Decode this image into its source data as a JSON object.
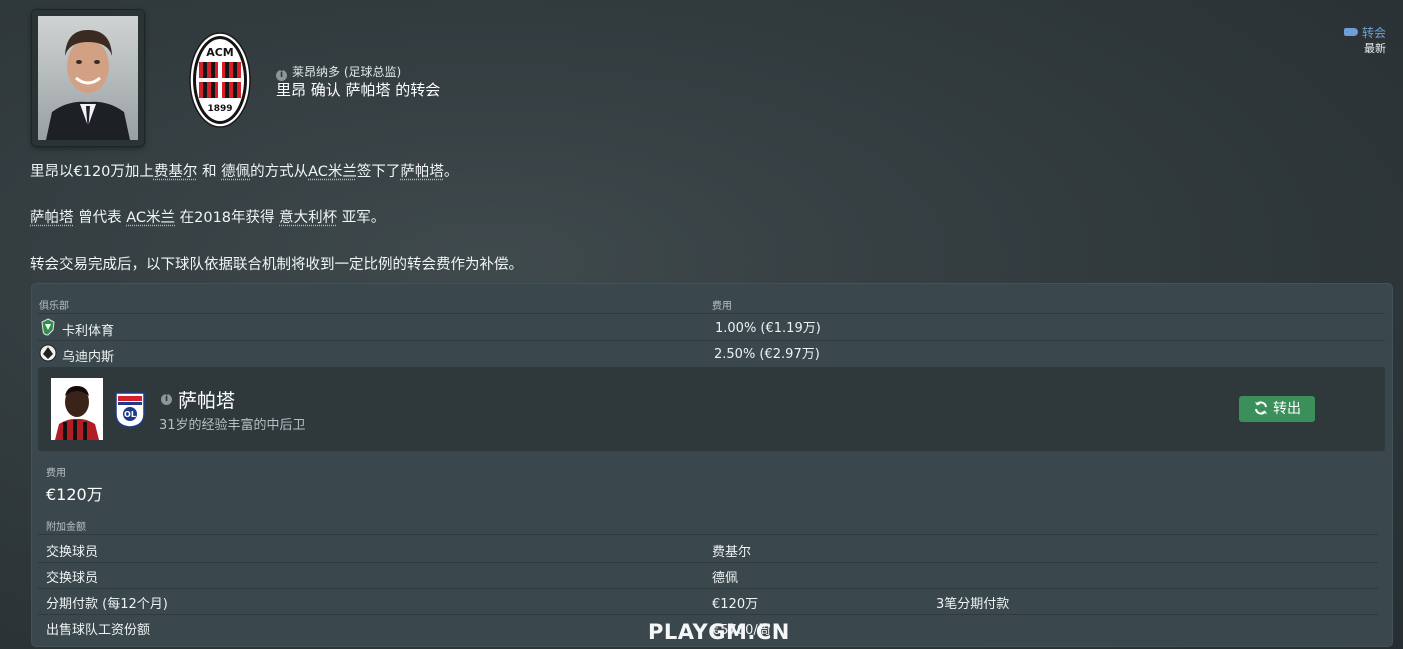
{
  "header": {
    "news_tag": "转会",
    "news_time": "最新",
    "author": "莱昂纳多 (足球总监)",
    "headline": "里昂 确认 萨帕塔 的转会"
  },
  "body": {
    "p1": {
      "pre": "里昂以€120万加上",
      "player1": "费基尔",
      "and": " 和 ",
      "player2": "德佩",
      "mid": "的方式从",
      "club": "AC米兰",
      "mid2": "签下了",
      "player": "萨帕塔",
      "end": "。"
    },
    "p2": {
      "player": "萨帕塔",
      "pre": " 曾代表 ",
      "club": "AC米兰",
      "mid": " 在2018年获得 ",
      "trophy": "意大利杯",
      "end": " 亚军。"
    },
    "p3": "转会交易完成后，以下球队依据联合机制将收到一定比例的转会费作为补偿。"
  },
  "solidarity": {
    "col_club": "俱乐部",
    "col_fee": "费用",
    "rows": [
      {
        "club": "卡利体育",
        "fee": "1.00% (€1.19万)"
      },
      {
        "club": "乌迪内斯",
        "fee": "2.50% (€2.97万)"
      }
    ]
  },
  "player": {
    "name": "萨帕塔",
    "description": "31岁的经验丰富的中后卫",
    "action": "转出"
  },
  "fee": {
    "label": "费用",
    "value": "€120万"
  },
  "extras": {
    "label": "附加金额",
    "rows": [
      {
        "label": "交换球员",
        "value": "费基尔",
        "extra": ""
      },
      {
        "label": "交换球员",
        "value": "德佩",
        "extra": ""
      },
      {
        "label": "分期付款 (每12个月)",
        "value": "€120万",
        "extra": "3笔分期付款"
      },
      {
        "label": "出售球队工资份额",
        "value": "€5700/周",
        "extra": ""
      }
    ]
  },
  "watermark": "PLAYGM.CN",
  "colors": {
    "accent_button": "#3b8f5a",
    "tag": "#6f9fd6",
    "milan_red": "#d51f2a"
  },
  "icons": {
    "info": "info-icon",
    "tag": "tag-icon",
    "refresh": "refresh-icon"
  }
}
